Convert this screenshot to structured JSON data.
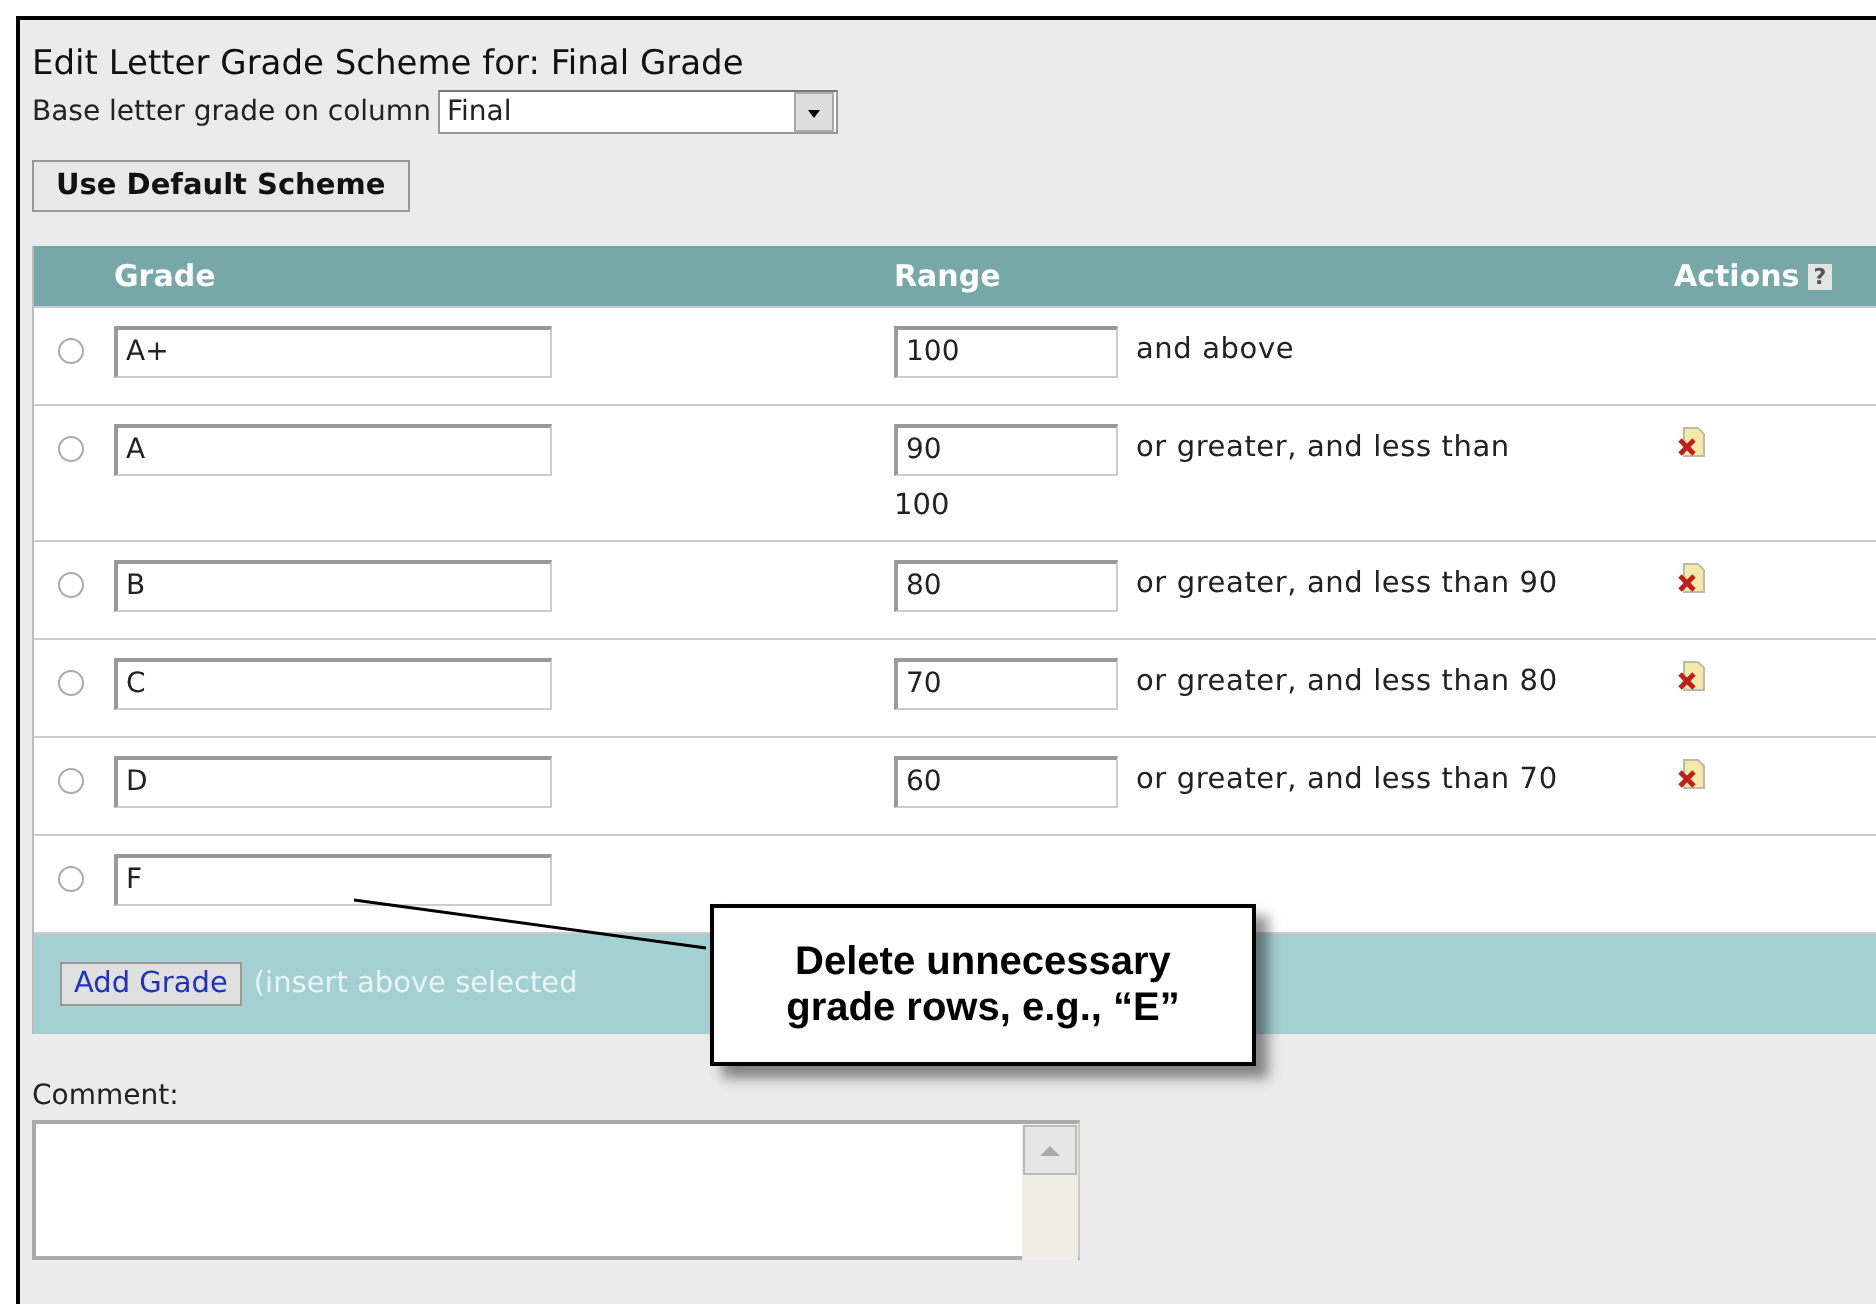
{
  "title": "Edit Letter Grade Scheme for: Final Grade",
  "base_column": {
    "label": "Base letter grade on column",
    "value": "Final"
  },
  "default_button": "Use Default Scheme",
  "table": {
    "columns": [
      "Grade",
      "Range",
      "Actions"
    ],
    "help": "?",
    "rows": [
      {
        "selected": false,
        "grade": "A+",
        "range": "100",
        "suffix": "and above",
        "deletable": false
      },
      {
        "selected": false,
        "grade": "A",
        "range": "90",
        "suffix": "or greater, and less than",
        "suffix_line2": "100",
        "deletable": true
      },
      {
        "selected": false,
        "grade": "B",
        "range": "80",
        "suffix": "or greater, and less than 90",
        "deletable": true
      },
      {
        "selected": false,
        "grade": "C",
        "range": "70",
        "suffix": "or greater, and less than 80",
        "deletable": true
      },
      {
        "selected": false,
        "grade": "D",
        "range": "60",
        "suffix": "or greater, and less than 70",
        "deletable": true
      },
      {
        "selected": false,
        "grade": "F",
        "deletable": false
      }
    ],
    "add_button": "Add Grade",
    "add_hint": "(insert above selected"
  },
  "comment": {
    "label": "Comment:"
  },
  "callout": "Delete unnecessary grade rows, e.g., “E”"
}
